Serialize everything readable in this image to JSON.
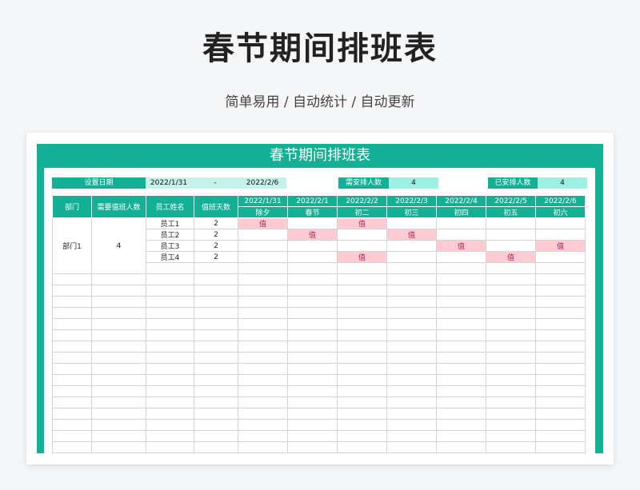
{
  "page": {
    "title": "春节期间排班表",
    "subtitle": "简单易用 / 自动统计 / 自动更新"
  },
  "sheet": {
    "header": "春节期间排班表",
    "info": {
      "date_label": "设置日期",
      "date_start": "2022/1/31",
      "date_sep": "-",
      "date_end": "2022/2/6",
      "need_label": "需安排人数",
      "need_value": "4",
      "done_label": "已安排人数",
      "done_value": "4"
    },
    "columns": {
      "dept": "部门",
      "need": "需要值班人数",
      "name": "员工姓名",
      "days": "值班天数"
    },
    "dates": [
      {
        "date": "2022/1/31",
        "day": "除夕"
      },
      {
        "date": "2022/2/1",
        "day": "春节"
      },
      {
        "date": "2022/2/2",
        "day": "初二"
      },
      {
        "date": "2022/2/3",
        "day": "初三"
      },
      {
        "date": "2022/2/4",
        "day": "初四"
      },
      {
        "date": "2022/2/5",
        "day": "初五"
      },
      {
        "date": "2022/2/6",
        "day": "初六"
      }
    ],
    "group": {
      "dept": "部门1",
      "need": "4"
    },
    "duty_mark": "值",
    "employees": [
      {
        "name": "员工1",
        "days": "2",
        "duty": [
          1,
          0,
          1,
          0,
          0,
          0,
          0
        ]
      },
      {
        "name": "员工2",
        "days": "2",
        "duty": [
          0,
          1,
          0,
          1,
          0,
          0,
          0
        ]
      },
      {
        "name": "员工3",
        "days": "2",
        "duty": [
          0,
          0,
          0,
          0,
          1,
          0,
          1
        ]
      },
      {
        "name": "员工4",
        "days": "2",
        "duty": [
          0,
          0,
          1,
          0,
          0,
          1,
          0
        ]
      }
    ],
    "colors": {
      "accent": "#14b096",
      "duty_bg": "#ffcbd2",
      "duty_text": "#c2185b",
      "light": "#9cf1e2"
    }
  }
}
